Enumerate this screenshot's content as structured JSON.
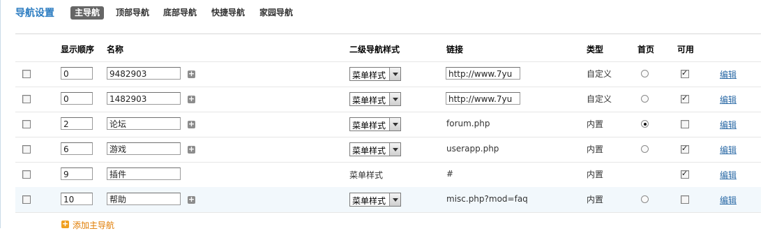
{
  "header": {
    "title": "导航设置",
    "tabs": [
      {
        "label": "主导航",
        "active": true
      },
      {
        "label": "顶部导航",
        "active": false
      },
      {
        "label": "底部导航",
        "active": false
      },
      {
        "label": "快捷导航",
        "active": false
      },
      {
        "label": "家园导航",
        "active": false
      }
    ]
  },
  "table": {
    "headers": {
      "order": "显示顺序",
      "name": "名称",
      "submenu_style": "二级导航样式",
      "link": "链接",
      "type": "类型",
      "home": "首页",
      "enabled": "可用"
    },
    "edit_label": "编辑",
    "rows": [
      {
        "checked": false,
        "order": "0",
        "name": "9482903",
        "has_plus": true,
        "style": "菜单样式",
        "style_select": true,
        "link": "http://www.7yu",
        "link_input": true,
        "type": "自定义",
        "home": false,
        "home_radio": true,
        "enabled": true
      },
      {
        "checked": false,
        "order": "0",
        "name": "1482903",
        "has_plus": true,
        "style": "菜单样式",
        "style_select": true,
        "link": "http://www.7yu",
        "link_input": true,
        "type": "自定义",
        "home": false,
        "home_radio": true,
        "enabled": true
      },
      {
        "checked": false,
        "order": "2",
        "name": "论坛",
        "has_plus": true,
        "style": "菜单样式",
        "style_select": true,
        "link": "forum.php",
        "link_input": false,
        "type": "内置",
        "home": true,
        "home_radio": true,
        "enabled": false
      },
      {
        "checked": false,
        "order": "6",
        "name": "游戏",
        "has_plus": true,
        "style": "菜单样式",
        "style_select": true,
        "link": "userapp.php",
        "link_input": false,
        "type": "内置",
        "home": false,
        "home_radio": true,
        "enabled": true
      },
      {
        "checked": false,
        "order": "9",
        "name": "插件",
        "has_plus": false,
        "style": "菜单样式",
        "style_select": false,
        "link": "#",
        "link_input": false,
        "type": "内置",
        "home": false,
        "home_radio": false,
        "enabled": true
      },
      {
        "checked": false,
        "order": "10",
        "name": "帮助",
        "has_plus": true,
        "style": "菜单样式",
        "style_select": true,
        "link": "misc.php?mod=faq",
        "link_input": false,
        "type": "内置",
        "home": false,
        "home_radio": true,
        "enabled": false,
        "highlight": true
      }
    ]
  },
  "footer": {
    "add_label": "添加主导航"
  },
  "colors": {
    "title": "#2b7cc1",
    "active_tab_bg": "#666666",
    "link": "#2b6aa6",
    "add": "#e07b00",
    "row_highlight": "#f2f8fc"
  }
}
